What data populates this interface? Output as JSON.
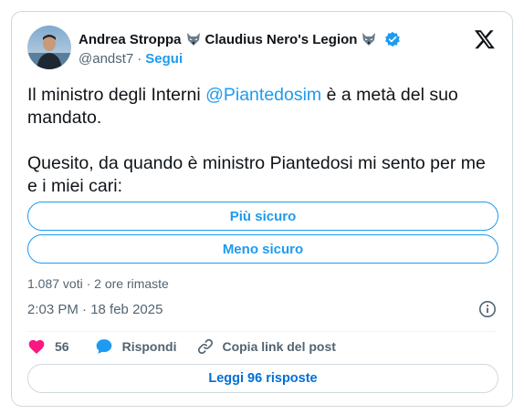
{
  "author": {
    "display_name": "Andrea Stroppa",
    "name_suffix": "Claudius Nero's Legion",
    "handle": "@andst7",
    "follow_label": "Segui",
    "separator": "·"
  },
  "tweet": {
    "text_before_mention": "Il ministro degli Interni ",
    "mention": "@Piantedosim",
    "text_after_mention": " è a metà del suo mandato.",
    "paragraph2": "Quesito, da quando è ministro Piantedosi mi sento per me e i miei cari:"
  },
  "poll": {
    "options": [
      {
        "label": "Più sicuro"
      },
      {
        "label": "Meno sicuro"
      }
    ],
    "meta": "1.087 voti · 2 ore rimaste"
  },
  "timestamp": "2:03 PM · 18 feb 2025",
  "actions": {
    "like_count": "56",
    "reply_label": "Rispondi",
    "copy_label": "Copia link del post"
  },
  "read_replies_label": "Leggi 96 risposte",
  "colors": {
    "accent": "#1d9bf0",
    "like": "#f91880",
    "text": "#0f1419",
    "secondary": "#536471"
  },
  "icons": [
    "wolf-icon",
    "verified-badge-icon",
    "x-logo-icon",
    "info-icon",
    "heart-icon",
    "reply-bubble-icon",
    "link-icon"
  ]
}
